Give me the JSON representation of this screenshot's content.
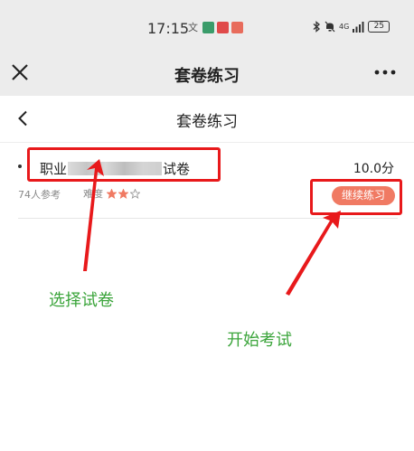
{
  "status_bar": {
    "time": "17:15",
    "network_label": "4G",
    "battery_level": "25",
    "icons": [
      "bluetooth-icon",
      "mute-icon",
      "signal-icon",
      "battery-icon"
    ]
  },
  "app_bar": {
    "title": "套卷练习",
    "close_icon": "close-icon",
    "more_icon": "more-icon"
  },
  "page_header": {
    "title": "套卷练习",
    "back_icon": "chevron-left-icon"
  },
  "paper": {
    "name_prefix": "职业",
    "name_suffix": "试卷",
    "score": "10.0分",
    "participants": "74人参考",
    "difficulty_label": "难度",
    "stars_filled": 2,
    "stars_total": 3,
    "continue_label": "继续练习"
  },
  "annotations": {
    "select_paper": "选择试卷",
    "start_exam": "开始考试"
  },
  "colors": {
    "accent_button": "#f07a63",
    "highlight_red": "#e8191b",
    "annotation_green": "#3aa43a",
    "star_filled": "#f07a63",
    "topbar_bg": "#ececec"
  }
}
